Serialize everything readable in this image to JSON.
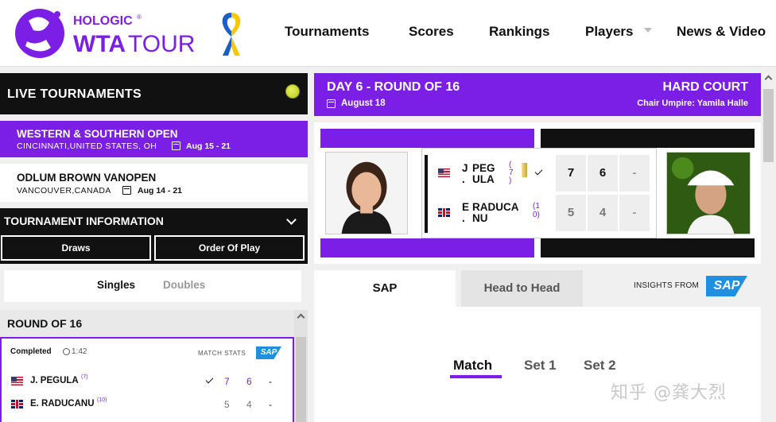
{
  "brand": {
    "hologic": "HOLOGIC",
    "registered": "®",
    "wta": "WTA",
    "tour": "TOUR"
  },
  "nav": [
    "Tournaments",
    "Scores",
    "Rankings",
    "Players",
    "News & Video"
  ],
  "colors": {
    "purple": "#7b1fe6",
    "black": "#111111",
    "sap_blue": "#1f8fe0"
  },
  "live": {
    "title": "LIVE TOURNAMENTS",
    "icon": "tennis-ball-icon"
  },
  "tournaments": [
    {
      "name": "WESTERN & SOUTHERN OPEN",
      "location": "CINCINNATI,UNITED STATES, OH",
      "dates": "Aug 15 - 21"
    },
    {
      "name": "ODLUM BROWN VANOPEN",
      "location": "VANCOUVER,CANADA",
      "dates": "Aug 14 - 21"
    }
  ],
  "tinfo": {
    "title": "TOURNAMENT INFORMATION",
    "draws": "Draws",
    "order": "Order Of Play"
  },
  "segments": {
    "singles": "Singles",
    "doubles": "Doubles"
  },
  "round": "ROUND OF 16",
  "card": {
    "status": "Completed",
    "duration": "1:42",
    "match_stats": "MATCH STATS",
    "sap": "SAP",
    "players": [
      {
        "name": "J. PEGULA",
        "seed": "(7)",
        "s1": "7",
        "s2": "6",
        "s3": "-"
      },
      {
        "name": "E. RADUCANU",
        "seed": "(10)",
        "s1": "5",
        "s2": "4",
        "s3": "-"
      }
    ]
  },
  "match": {
    "round": "DAY 6 - ROUND OF 16",
    "date": "August 18",
    "court": "HARD COURT",
    "umpire": "Chair Umpire: Yamila Halle",
    "p1": {
      "first": "J",
      "dot": ".",
      "last1": "PEG",
      "last2": "ULA",
      "seed_a": "(",
      "seed_b": "7",
      "seed_c": ")",
      "s1": "7",
      "s2": "6",
      "s3": "-"
    },
    "p2": {
      "first": "E",
      "dot": ".",
      "last1": "RADUCA",
      "last2": "NU",
      "seed_a": "(1",
      "seed_b": "0)",
      "s1": "5",
      "s2": "4",
      "s3": "-"
    }
  },
  "stats_tabs": {
    "sap": "SAP",
    "h2h": "Head to Head",
    "insights": "INSIGHTS FROM"
  },
  "subtabs": [
    "Match",
    "Set 1",
    "Set 2"
  ],
  "watermark": "知乎 @龚大烈"
}
